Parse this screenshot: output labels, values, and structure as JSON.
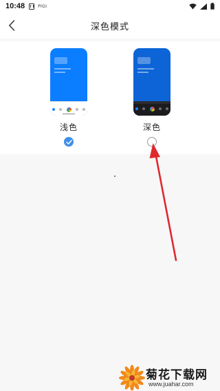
{
  "status_bar": {
    "time": "10:48",
    "network_label": "PIGI",
    "icons": [
      "app-notification-icon",
      "wifi-icon",
      "signal-icon",
      "battery-icon"
    ]
  },
  "header": {
    "title": "深色模式",
    "back_icon": "chevron-left-icon"
  },
  "theme_options": [
    {
      "label": "浅色",
      "selected": true,
      "preview_color": "#0b7dff"
    },
    {
      "label": "深色",
      "selected": false,
      "preview_color": "#0c64d6"
    }
  ],
  "colors": {
    "accent": "#3f8fe8",
    "annotation_arrow": "#e0282e",
    "page_background": "#f7f7f8"
  },
  "watermark": {
    "title": "菊花下载网",
    "url": "www.juahar.com",
    "icon": "chrysanthemum-logo"
  }
}
